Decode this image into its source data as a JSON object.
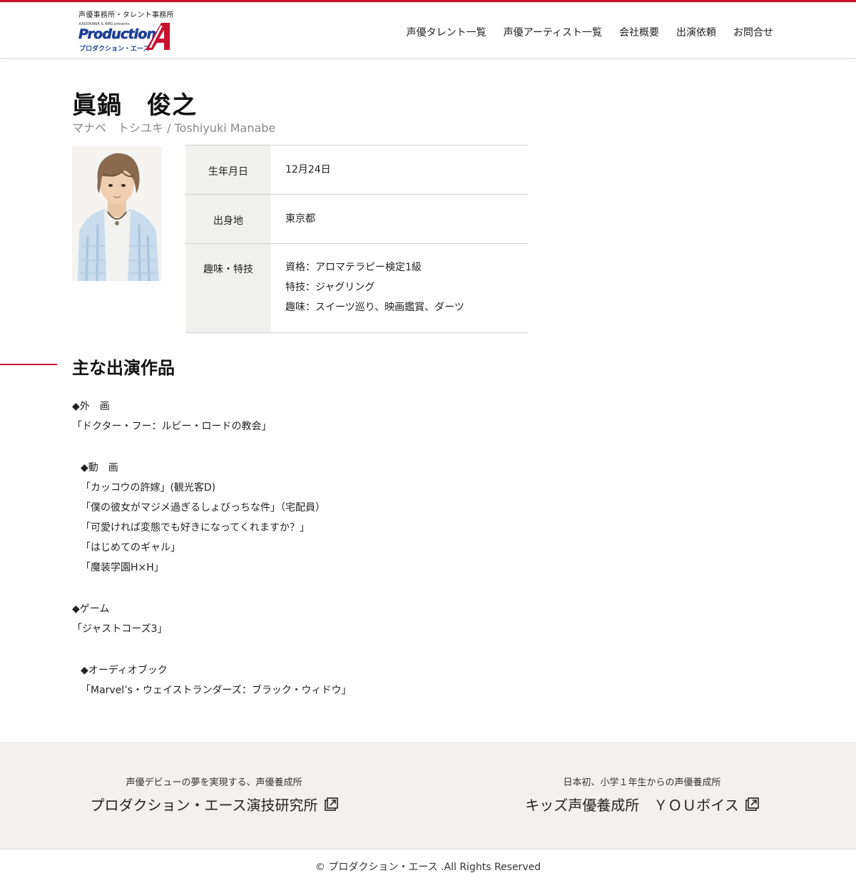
{
  "header": {
    "tagline": "声優事務所・タレント事務所",
    "logo_sub": "KADOKAWA & AMG presents",
    "logo_word": "Production",
    "logo_kana": "プロダクション・エース",
    "nav": [
      "声優タレント一覧",
      "声優アーティスト一覧",
      "会社概要",
      "出演依頼",
      "お問合せ"
    ]
  },
  "profile": {
    "name": "眞鍋　俊之",
    "kana": "マナベ　トシユキ / Toshiyuki Manabe",
    "rows": [
      {
        "label": "生年月日",
        "values": [
          "12月24日"
        ]
      },
      {
        "label": "出身地",
        "values": [
          "東京都"
        ]
      },
      {
        "label": "趣味・特技",
        "values": [
          "資格：アロマテラピー検定1級",
          "特技：ジャグリング",
          "趣味：スイーツ巡り、映画鑑賞、ダーツ"
        ]
      }
    ]
  },
  "works": {
    "title": "主な出演作品",
    "movie_heading": "◆外　画",
    "movie_item": "「ドクター・フー：ルビー・ロードの教会」",
    "video_heading": "◆動　画",
    "video_items": [
      "「カッコウの許嫁」(観光客D)",
      "「僕の彼女がマジメ過ぎるしょびっちな件」（宅配員）",
      "「可愛ければ変態でも好きになってくれますか？」",
      "「はじめてのギャル」",
      "「魔装学園H×H」"
    ],
    "game_heading": "◆ゲーム",
    "game_item": "「ジャストコーズ3」",
    "audio_heading": "◆オーディオブック",
    "audio_item": "「Marvel’s・ウェイストランダーズ：ブラック・ウィドウ」"
  },
  "footer": {
    "col1_sub": "声優デビューの夢を実現する、声優養成所",
    "col1_link": "プロダクション・エース演技研究所",
    "col2_sub": "日本初、小学１年生からの声優養成所",
    "col2_link": "キッズ声優養成所　ＹＯＵボイス",
    "copyright": "© プロダクション・エース .All Rights Reserved"
  },
  "colors": {
    "accent": "#c8102e",
    "brand_blue": "#1f3f95",
    "table_header_bg": "#f0f0ee",
    "footer_bg": "#f2f1ef"
  }
}
